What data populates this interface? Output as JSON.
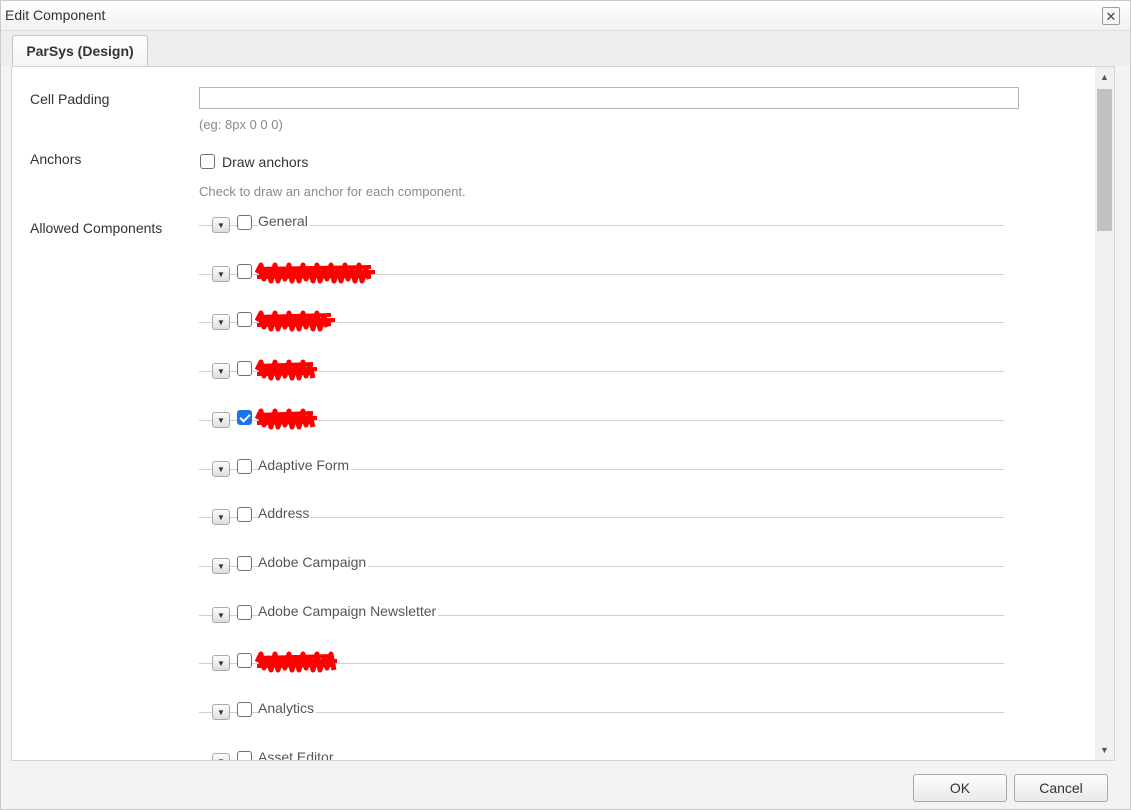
{
  "dialog": {
    "title": "Edit Component",
    "close_symbol": "✕"
  },
  "tabs": [
    {
      "label": "ParSys (Design)",
      "active": true
    }
  ],
  "form": {
    "cell_padding": {
      "label": "Cell Padding",
      "value": "",
      "hint": "(eg: 8px 0 0 0)"
    },
    "anchors": {
      "label": "Anchors",
      "checkbox_label": "Draw anchors",
      "checked": false,
      "hint": "Check to draw an anchor for each component."
    },
    "allowed_components": {
      "label": "Allowed Components",
      "expander_icon": "triangle-down-icon",
      "groups": [
        {
          "label": "General",
          "checked": false,
          "redacted": false
        },
        {
          "label": "",
          "checked": false,
          "redacted": true
        },
        {
          "label": "",
          "checked": false,
          "redacted": true
        },
        {
          "label": "",
          "checked": false,
          "redacted": true
        },
        {
          "label": "",
          "checked": true,
          "redacted": true
        },
        {
          "label": "Adaptive Form",
          "checked": false,
          "redacted": false
        },
        {
          "label": "Address",
          "checked": false,
          "redacted": false
        },
        {
          "label": "Adobe Campaign",
          "checked": false,
          "redacted": false
        },
        {
          "label": "Adobe Campaign Newsletter",
          "checked": false,
          "redacted": false
        },
        {
          "label": "",
          "checked": false,
          "redacted": true
        },
        {
          "label": "Analytics",
          "checked": false,
          "redacted": false
        },
        {
          "label": "Asset Editor",
          "checked": false,
          "redacted": false
        }
      ]
    }
  },
  "footer": {
    "ok_label": "OK",
    "cancel_label": "Cancel"
  },
  "colors": {
    "checkbox_checked": "#1a73e8",
    "redaction": "#ff0000"
  }
}
